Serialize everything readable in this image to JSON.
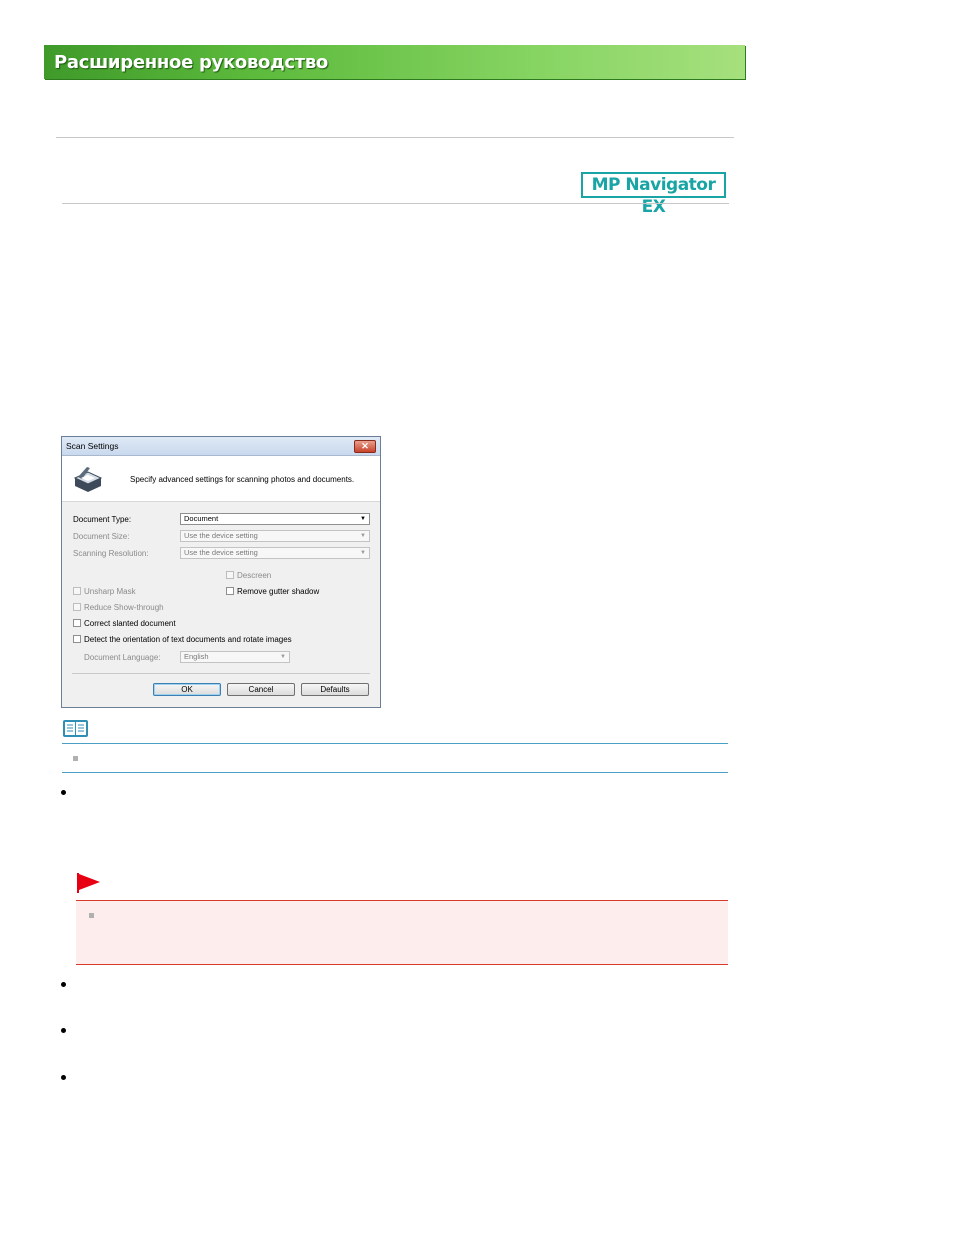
{
  "header": {
    "banner_title": "Расширенное руководство",
    "logo_text": "MP Navigator EX"
  },
  "dialog": {
    "title": "Scan Settings",
    "close_label": "✕",
    "description": "Specify advanced settings for scanning photos and documents.",
    "document_type_label": "Document Type:",
    "document_type_value": "Document",
    "document_size_label": "Document Size:",
    "document_size_value": "Use the device setting",
    "scanning_resolution_label": "Scanning Resolution:",
    "scanning_resolution_value": "Use the device setting",
    "descreen_label": "Descreen",
    "unsharp_mask_label": "Unsharp Mask",
    "remove_gutter_label": "Remove gutter shadow",
    "reduce_showthrough_label": "Reduce Show-through",
    "correct_slanted_label": "Correct slanted document",
    "detect_orientation_label": "Detect the orientation of text documents and rotate images",
    "document_language_label": "Document Language:",
    "document_language_value": "English",
    "ok_label": "OK",
    "cancel_label": "Cancel",
    "defaults_label": "Defaults"
  },
  "colors": {
    "banner_green": "#5cba3c",
    "logo_teal": "#19a5a5",
    "note_blue": "#4aa0c4",
    "warning_red": "#d93a2e",
    "warning_bg": "#fdeeed"
  },
  "icons": [
    "note-book-icon",
    "warning-flag-icon",
    "scanner-icon"
  ]
}
